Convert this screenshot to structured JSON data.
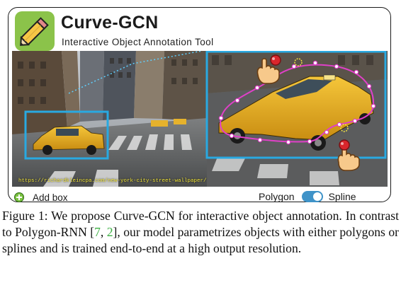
{
  "app": {
    "title": "Curve-GCN",
    "subtitle": "Interactive Object Annotation Tool"
  },
  "image": {
    "source_url": "https://richardkleincpa.com/new-york-city-street-wallpaper/"
  },
  "controls": {
    "add_box_label": "Add box",
    "mode_left_label": "Polygon",
    "mode_right_label": "Spline",
    "mode_selected": "Spline"
  },
  "caption": {
    "prefix": "Figure 1:",
    "part1": "We propose Curve-GCN for interactive object annotation. In contrast to Polygon-RNN [",
    "ref1": "7",
    "sep": ", ",
    "ref2": "2",
    "part2": "], our model parametrizes objects with either polygons or splines and is trained end-to-end at a high output resolution."
  },
  "colors": {
    "box_outline": "#29a9e1",
    "spline": "#e040c8",
    "citation": "#3cb043",
    "toggle_track": "#3f93c8",
    "logo_bg": "#8bc34a",
    "pointer_dot": "#d9262c"
  },
  "icons": [
    "pencil-logo-icon",
    "add-circle-icon",
    "hand-pointer-icon"
  ]
}
